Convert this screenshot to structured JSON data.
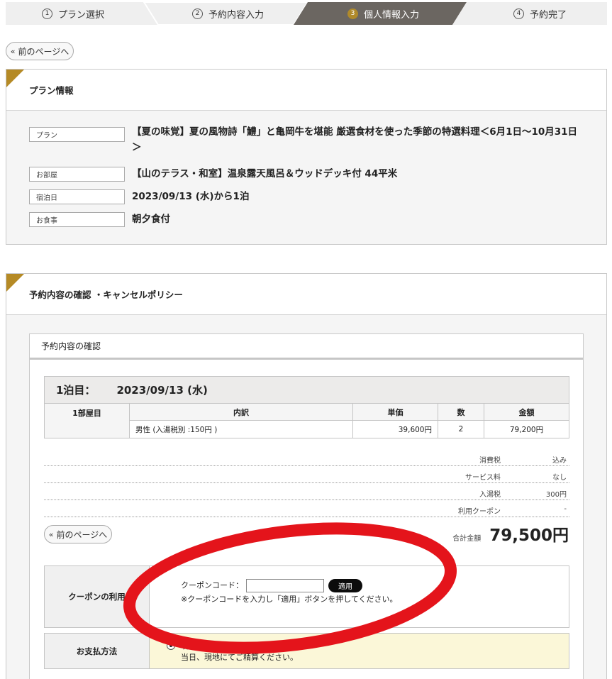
{
  "steps": [
    {
      "num": "1",
      "label": "プラン選択"
    },
    {
      "num": "2",
      "label": "予約内容入力"
    },
    {
      "num": "3",
      "label": "個人情報入力"
    },
    {
      "num": "4",
      "label": "予約完了"
    }
  ],
  "back_label": "前のページへ",
  "plan_panel": {
    "title": "プラン情報",
    "rows": [
      {
        "label": "プラン",
        "value": "【夏の味覚】夏の風物詩「鱧」と亀岡牛を堪能 厳選食材を使った季節の特選料理＜6月1日〜10月31日＞"
      },
      {
        "label": "お部屋",
        "value": "【山のテラス・和室】温泉露天風呂＆ウッドデッキ付 44平米"
      },
      {
        "label": "宿泊日",
        "value": "2023/09/13 (水)から1泊"
      },
      {
        "label": "お食事",
        "value": "朝夕食付"
      }
    ]
  },
  "confirm_panel": {
    "title": "予約内容の確認 ・キャンセルポリシー",
    "sub_title": "予約内容の確認",
    "night_label": "1泊目：",
    "night_date": "2023/09/13 (水)",
    "room_label": "1部屋目",
    "columns": [
      "内訳",
      "単価",
      "数",
      "金額"
    ],
    "line": {
      "desc": "男性 (入湯税別 :150円 )",
      "unit": "39,600円",
      "qty": "2",
      "amount": "79,200円"
    },
    "summary": [
      {
        "label": "消費税",
        "value": "込み"
      },
      {
        "label": "サービス料",
        "value": "なし"
      },
      {
        "label": "入湯税",
        "value": "300円"
      },
      {
        "label": "利用クーポン",
        "value": "-"
      }
    ],
    "total_label": "合計金額",
    "total_value": "79,500円",
    "coupon": {
      "label": "クーポンの利用",
      "field_label": "クーポンコード：",
      "apply": "適用",
      "note": "※クーポンコードを入力し「適用」ボタンを押してください。"
    },
    "payment": {
      "label": "お支払方法",
      "option": "現地決済",
      "note": "当日、現地にてご精算ください。"
    }
  },
  "colors": {
    "accent": "#b58a25",
    "active_step": "#6b6661",
    "annotation": "#e4141b"
  }
}
